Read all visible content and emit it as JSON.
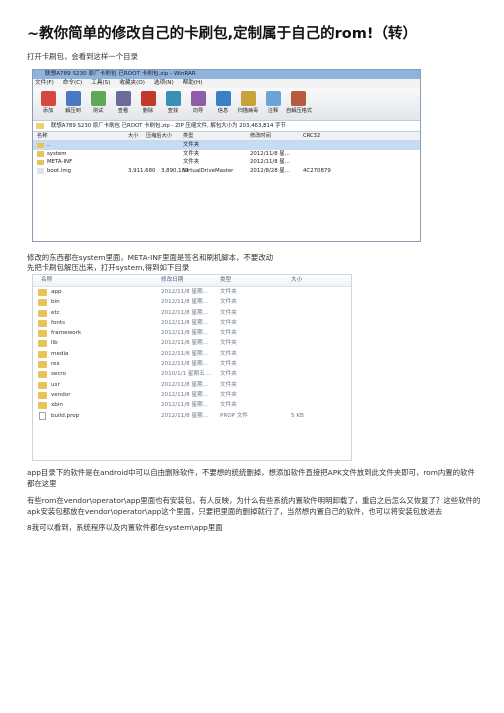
{
  "title": "~教你简单的修改自己的卡刷包,定制属于自己的rom!（转）",
  "intro": "打开卡刷包，会看到这样一个目录",
  "winrar": {
    "window_title": "联想A789 S230 原厂卡刷包 已ROOT 卡刷包.zip - WinRAR",
    "menu": [
      "文件(F)",
      "命令(C)",
      "工具(S)",
      "收藏夹(O)",
      "选项(N)",
      "帮助(H)"
    ],
    "toolbar": [
      {
        "label": "添加",
        "color": "#d6473f"
      },
      {
        "label": "解压到",
        "color": "#4a78c2"
      },
      {
        "label": "测试",
        "color": "#5fa85a"
      },
      {
        "label": "查看",
        "color": "#6b6b9e"
      },
      {
        "label": "删除",
        "color": "#c0392b"
      },
      {
        "label": "查找",
        "color": "#3a8fb7"
      },
      {
        "label": "向导",
        "color": "#8e5ca8"
      },
      {
        "label": "信息",
        "color": "#3b7fc4"
      },
      {
        "label": "扫描病毒",
        "color": "#c9a23a"
      },
      {
        "label": "注释",
        "color": "#6aa4d8"
      },
      {
        "label": "自解压格式",
        "color": "#b85a3e"
      }
    ],
    "path": "联想A789 S230 原厂卡刷包 已ROOT 卡刷包.zip - ZIP 压缩文件, 解包大小为 203,463,814 字节",
    "columns": [
      "名称",
      "大小",
      "压缩后大小",
      "类型",
      "修改时间",
      "CRC32"
    ],
    "rows": [
      {
        "name": "..",
        "size": "",
        "packed": "",
        "type": "文件夹",
        "date": "",
        "crc": ""
      },
      {
        "name": "system",
        "size": "",
        "packed": "",
        "type": "文件夹",
        "date": "2012/11/8 星...",
        "crc": ""
      },
      {
        "name": "META-INF",
        "size": "",
        "packed": "",
        "type": "文件夹",
        "date": "2012/11/8 星...",
        "crc": ""
      },
      {
        "name": "boot.img",
        "size": "3,911,680",
        "packed": "3,890,189",
        "type": "VirtualDriveMaster",
        "date": "2012/8/28 星...",
        "crc": "4C270879"
      }
    ]
  },
  "para2": "修改的东西都在system里面，META-INF里面是签名和刷机脚本，不要改动",
  "para3": "先把卡刷包解压出来，打开system,得到如下目录",
  "explorer": {
    "columns": [
      "名称",
      "修改日期",
      "类型",
      "大小"
    ],
    "rows": [
      {
        "name": "app",
        "date": "2012/11/8 星期...",
        "type": "文件夹",
        "size": ""
      },
      {
        "name": "bin",
        "date": "2012/11/8 星期...",
        "type": "文件夹",
        "size": ""
      },
      {
        "name": "etc",
        "date": "2012/11/8 星期...",
        "type": "文件夹",
        "size": ""
      },
      {
        "name": "fonts",
        "date": "2012/11/8 星期...",
        "type": "文件夹",
        "size": ""
      },
      {
        "name": "framework",
        "date": "2012/11/8 星期...",
        "type": "文件夹",
        "size": ""
      },
      {
        "name": "lib",
        "date": "2012/11/8 星期...",
        "type": "文件夹",
        "size": ""
      },
      {
        "name": "media",
        "date": "2012/11/8 星期...",
        "type": "文件夹",
        "size": ""
      },
      {
        "name": "res",
        "date": "2012/11/8 星期...",
        "type": "文件夹",
        "size": ""
      },
      {
        "name": "secro",
        "date": "2010/1/1 星期五 ...",
        "type": "文件夹",
        "size": ""
      },
      {
        "name": "usr",
        "date": "2012/11/8 星期...",
        "type": "文件夹",
        "size": ""
      },
      {
        "name": "vendor",
        "date": "2012/11/8 星期...",
        "type": "文件夹",
        "size": ""
      },
      {
        "name": "xbin",
        "date": "2012/11/8 星期...",
        "type": "文件夹",
        "size": ""
      },
      {
        "name": "build.prop",
        "date": "2012/11/8 星期...",
        "type": "PROP 文件",
        "size": "5 KB"
      }
    ]
  },
  "para4": "app目录下的软件是在android中可以自由删除软件，不要想的统统删掉，想添加软件直接把APK文件放到此文件夹即可，rom内置的软件都在这里",
  "para5": "有些rom在vendor\\operator\\app里面也有安装包，有人反映，为什么有些系统内置软件明明卸载了，重启之后怎么又恢复了？这些软件的apk安装包都放在vendor\\operator\\app这个里面，只要把里面的删掉就行了，当然想内置自己的软件，也可以将安装包放进去",
  "para6": "8我可以看到，系统程序以及内置软件都在system\\app里面"
}
